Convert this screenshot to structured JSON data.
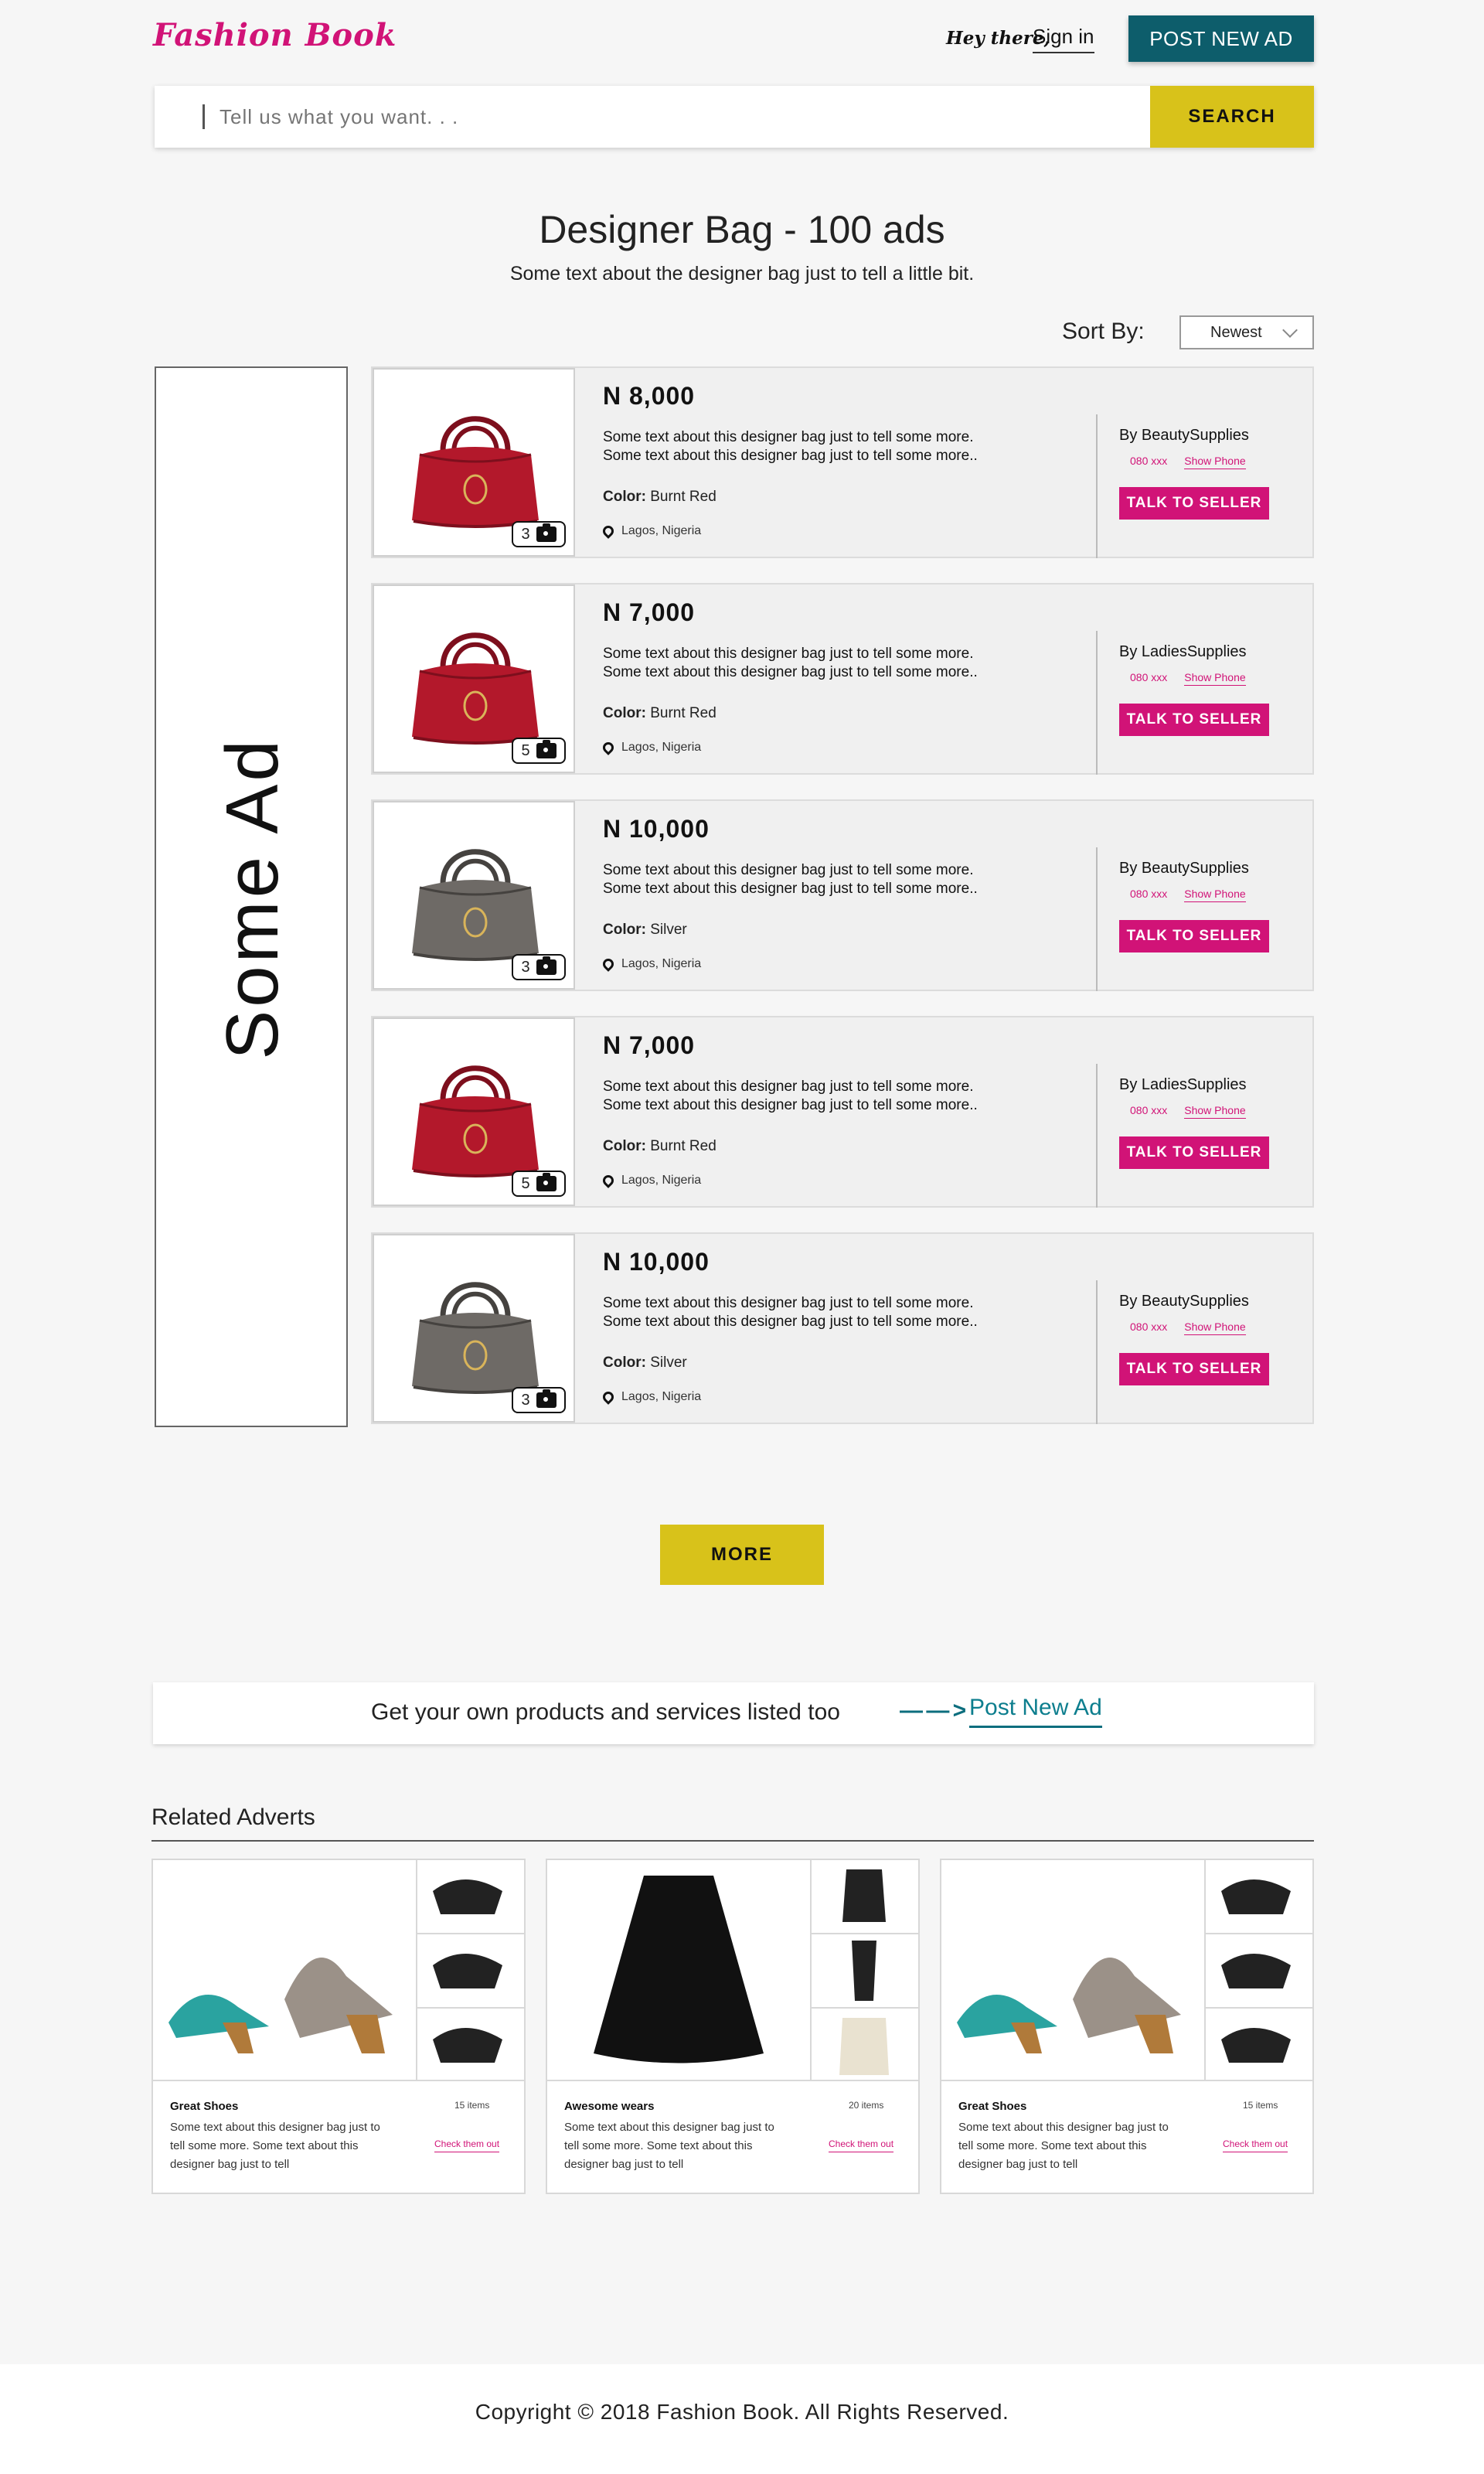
{
  "header": {
    "logo": "Fashion Book",
    "greeting": "Hey there,",
    "sign_in": "Sign in",
    "post_ad": "POST NEW AD"
  },
  "search": {
    "placeholder": "Tell us what you want. . .",
    "button": "SEARCH"
  },
  "category": {
    "title": "Designer Bag - 100 ads",
    "subtitle": "Some text about the designer bag just to tell a little bit."
  },
  "sort": {
    "label": "Sort By:",
    "selected": "Newest"
  },
  "side_ad": "Some Ad",
  "listings": [
    {
      "price": "N 8,000",
      "desc1": "Some text about this designer bag just to tell some more.",
      "desc2": "Some text about this designer bag just to tell some more..",
      "color_label": "Color:",
      "color": "Burnt Red",
      "location": "Lagos, Nigeria",
      "photos": "3",
      "seller": "By BeautySupplies",
      "phone": "080 xxx",
      "show_phone": "Show Phone",
      "talk": "TALK TO SELLER"
    },
    {
      "price": "N 7,000",
      "desc1": "Some text about this designer bag just to tell some more.",
      "desc2": "Some text about this designer bag just to tell some more..",
      "color_label": "Color:",
      "color": "Burnt Red",
      "location": "Lagos, Nigeria",
      "photos": "5",
      "seller": "By LadiesSupplies",
      "phone": "080 xxx",
      "show_phone": "Show Phone",
      "talk": "TALK TO SELLER"
    },
    {
      "price": "N 10,000",
      "desc1": "Some text about this designer bag just to tell some more.",
      "desc2": "Some text about this designer bag just to tell some more..",
      "color_label": "Color:",
      "color": "Silver",
      "location": "Lagos, Nigeria",
      "photos": "3",
      "seller": "By BeautySupplies",
      "phone": "080 xxx",
      "show_phone": "Show Phone",
      "talk": "TALK TO SELLER"
    },
    {
      "price": "N 7,000",
      "desc1": "Some text about this designer bag just to tell some more.",
      "desc2": "Some text about this designer bag just to tell some more..",
      "color_label": "Color:",
      "color": "Burnt Red",
      "location": "Lagos, Nigeria",
      "photos": "5",
      "seller": "By LadiesSupplies",
      "phone": "080 xxx",
      "show_phone": "Show Phone",
      "talk": "TALK TO SELLER"
    },
    {
      "price": "N 10,000",
      "desc1": "Some text about this designer bag just to tell some more.",
      "desc2": "Some text about this designer bag just to tell some more..",
      "color_label": "Color:",
      "color": "Silver",
      "location": "Lagos, Nigeria",
      "photos": "3",
      "seller": "By BeautySupplies",
      "phone": "080 xxx",
      "show_phone": "Show Phone",
      "talk": "TALK TO SELLER"
    }
  ],
  "more_button": "MORE",
  "cta": {
    "text": "Get your own products and services listed too",
    "arrow": "— — >",
    "link": "Post New Ad"
  },
  "related": {
    "title": "Related Adverts",
    "cards": [
      {
        "title": "Great Shoes",
        "count": "15 items",
        "desc": "Some text about this designer bag just to tell some more. Some text about this designer bag just to tell",
        "link": "Check them out"
      },
      {
        "title": "Awesome wears",
        "count": "20 items",
        "desc": "Some text about this designer bag just to tell some more. Some text about this designer bag just to tell",
        "link": "Check them out"
      },
      {
        "title": "Great Shoes",
        "count": "15 items",
        "desc": "Some text about this designer bag just to tell some more. Some text about this designer bag just to tell",
        "link": "Check them out"
      }
    ]
  },
  "footer": {
    "copyright": "Copyright © 2018 Fashion Book. All Rights Reserved."
  },
  "colors": {
    "brand_pink": "#d11377",
    "teal": "#0d5d6b",
    "yellow": "#d8c21a"
  }
}
